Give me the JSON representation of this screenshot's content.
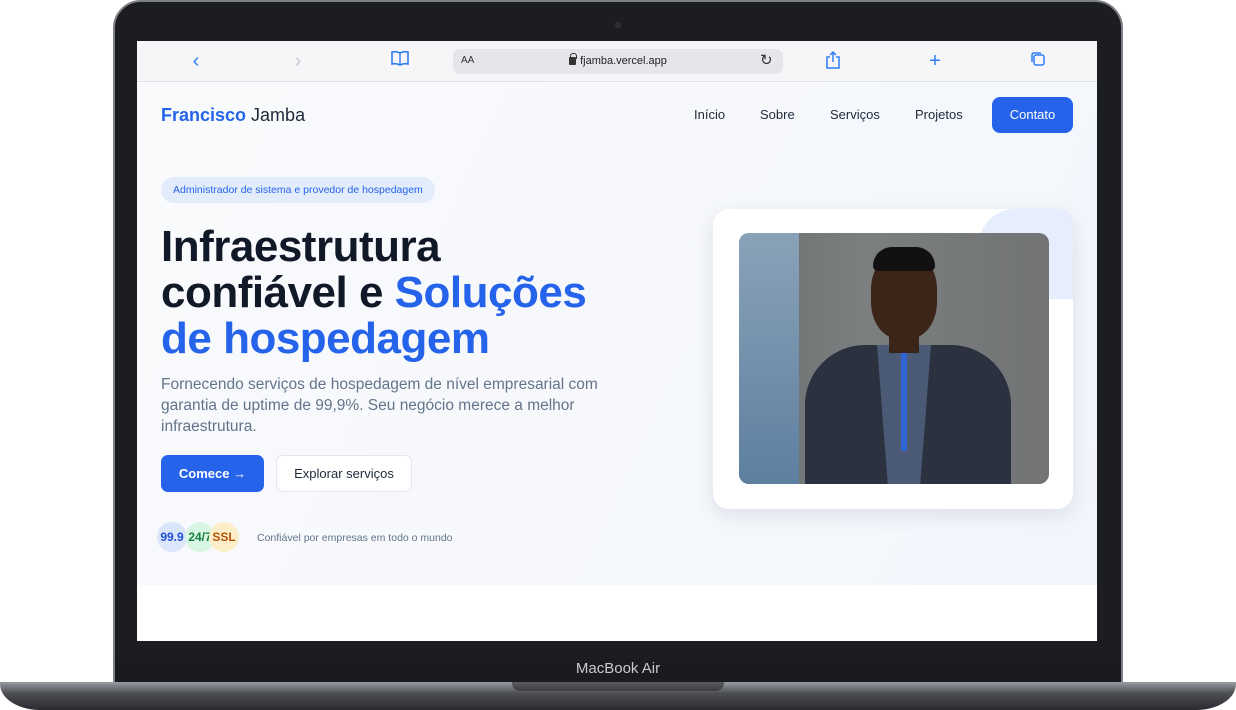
{
  "device": {
    "label": "MacBook Air"
  },
  "browser": {
    "reader_label": "AA",
    "url": "fjamba.vercel.app"
  },
  "site": {
    "logo_first": "Francisco",
    "logo_last": " Jamba",
    "nav": [
      "Início",
      "Sobre",
      "Serviços",
      "Projetos"
    ],
    "contact_label": "Contato"
  },
  "hero": {
    "pill": "Administrador de sistema e provedor de hospedagem",
    "title_line1": "Infraestrutura",
    "title_line2_a": "confiável e ",
    "title_line2_b": "Soluções",
    "title_line3": "de hospedagem",
    "description": "Fornecendo serviços de hospedagem de nível empresarial com garantia de uptime de 99,9%. Seu negócio merece a melhor infraestrutura.",
    "primary_label": "Comece →",
    "secondary_label": "Explorar serviços",
    "badges": [
      "99.9",
      "24/7",
      "SSL"
    ],
    "trust_text": "Confiável por empresas em todo o mundo"
  },
  "colors": {
    "accent": "#2563eb",
    "text": "#111827"
  }
}
